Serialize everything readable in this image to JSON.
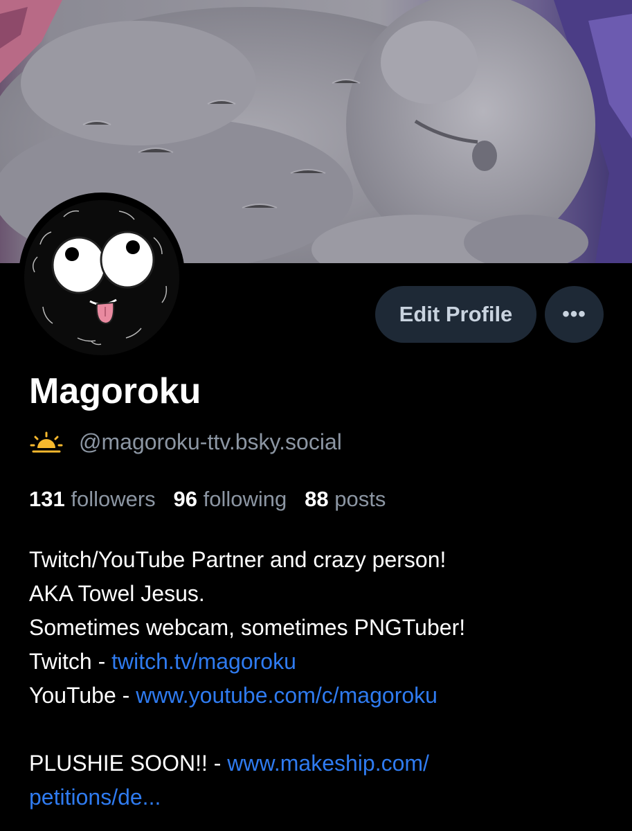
{
  "profile": {
    "display_name": "Magoroku",
    "handle": "@magoroku-ttv.bsky.social",
    "handle_icon": "sun-icon",
    "edit_label": "Edit Profile",
    "more_label": "•••"
  },
  "stats": {
    "followers_count": "131",
    "followers_label": "followers",
    "following_count": "96",
    "following_label": "following",
    "posts_count": "88",
    "posts_label": "posts"
  },
  "bio": {
    "line1": "Twitch/YouTube Partner and crazy person!",
    "line2": "AKA Towel Jesus.",
    "line3": "Sometimes webcam, sometimes PNGTuber!",
    "twitch_prefix": "Twitch - ",
    "twitch_link": "twitch.tv/magoroku",
    "youtube_prefix": "YouTube - ",
    "youtube_link": "www.youtube.com/c/magoroku",
    "plushie_prefix": "PLUSHIE SOON!! - ",
    "plushie_link_part1": "www.makeship.com/",
    "plushie_link_part2": "petitions/de..."
  },
  "colors": {
    "background": "#000000",
    "button_bg": "#1e2936",
    "link": "#2f7bf0",
    "muted_text": "#8c96a3",
    "icon_accent": "#f5b82e"
  }
}
